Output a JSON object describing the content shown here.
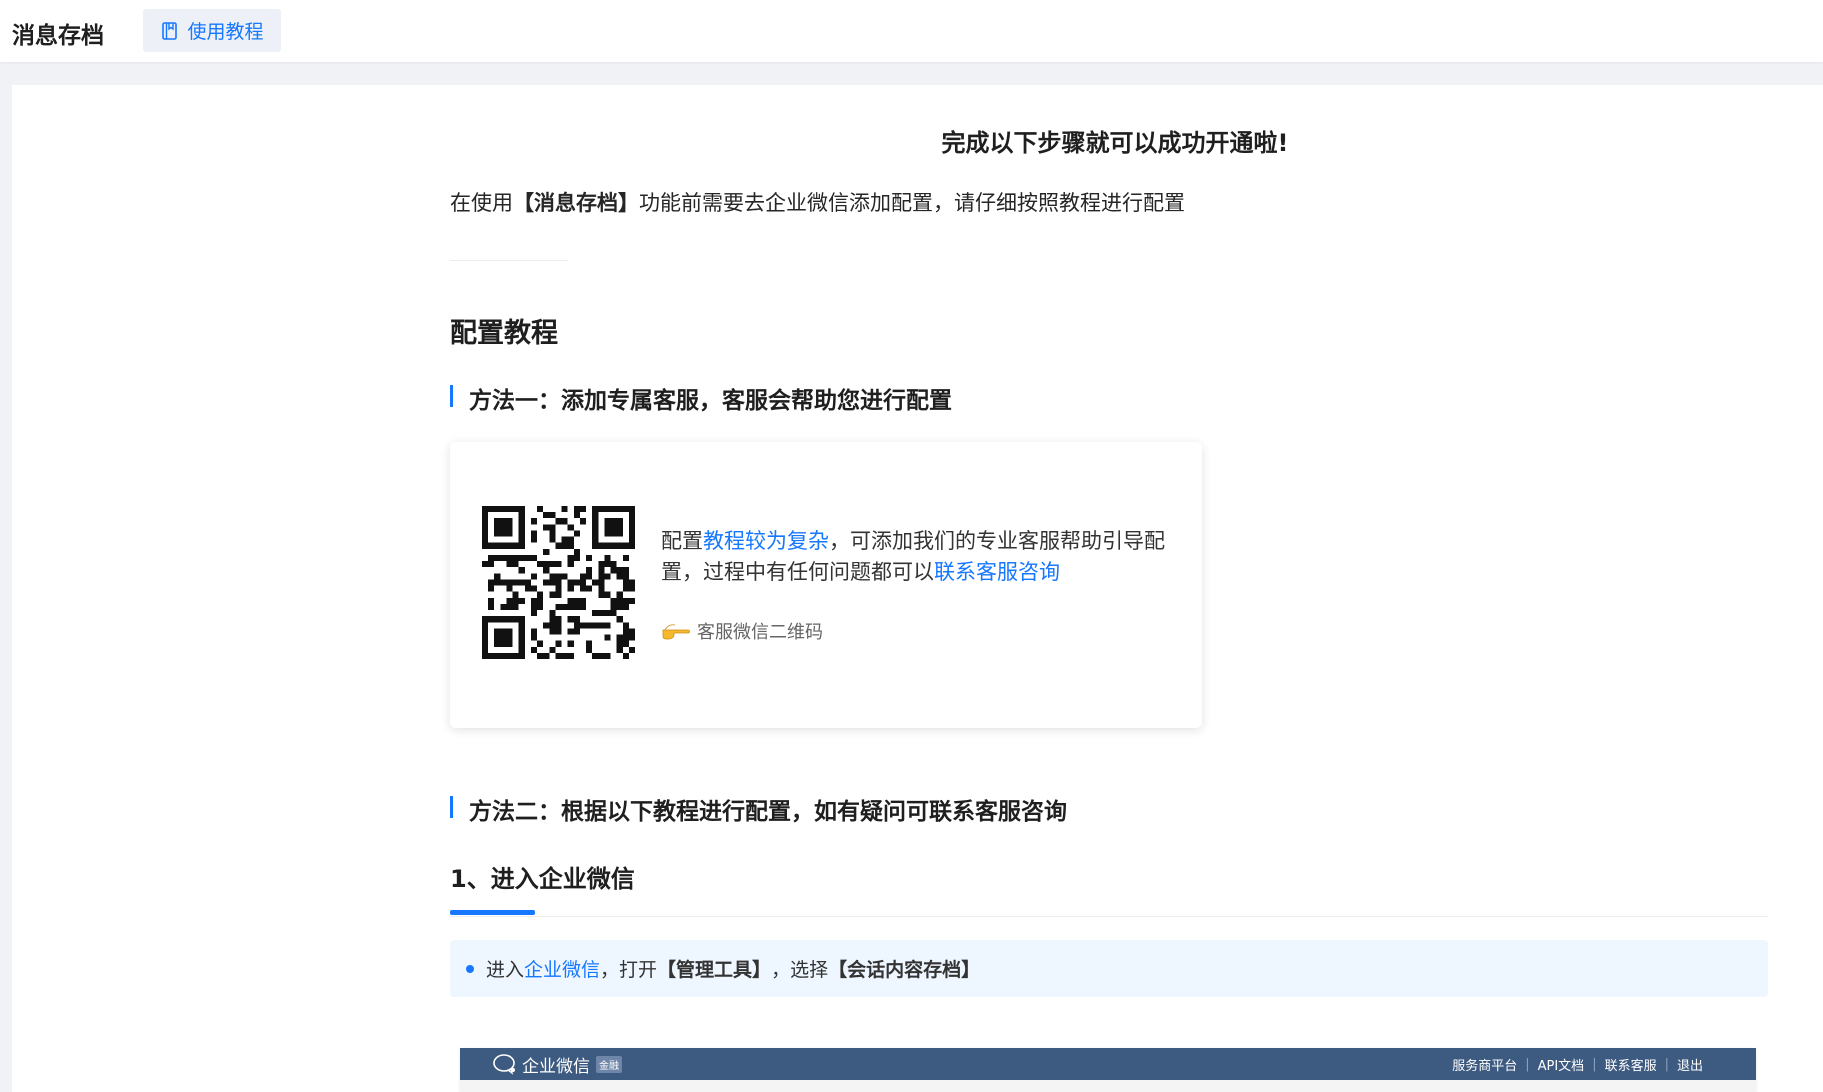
{
  "header": {
    "title": "消息存档",
    "tutorial_tab": "使用教程"
  },
  "main": {
    "headline": "完成以下步骤就可以成功开通啦!",
    "intro_prefix": "在使用",
    "intro_bold": "【消息存档】",
    "intro_suffix": "功能前需要去企业微信添加配置，请仔细按照教程进行配置",
    "config_heading": "配置教程",
    "method1_title": "方法一：添加专属客服，客服会帮助您进行配置",
    "qr_card": {
      "text_prefix": "配置",
      "text_link1": "教程较为复杂",
      "text_mid": "，可添加我们的专业客服帮助引导配置，过程中有任何问题都可以",
      "text_link2": "联系客服咨询",
      "hint": "客服微信二维码"
    },
    "method2_title": "方法二：根据以下教程进行配置，如有疑问可联系客服咨询",
    "step1_title": "1、进入企业微信",
    "tip": {
      "prefix": "进入",
      "link": "企业微信",
      "mid": "，打开",
      "bold1": "【管理工具】",
      "mid2": "，选择",
      "bold2": "【会话内容存档】"
    },
    "wx_screenshot": {
      "logo_text": "企业微信",
      "badge": "金融",
      "links": [
        "服务商平台",
        "API文档",
        "联系客服",
        "退出"
      ]
    }
  },
  "colors": {
    "accent": "#1677ff",
    "wx_bar": "#3d5a80",
    "tip_bg": "#eef6ff"
  },
  "icons": {
    "tutorial": "book-icon",
    "qr": "qr-code",
    "hint": "pointing-hand-icon",
    "wx_logo": "chat-bubble-icon"
  }
}
